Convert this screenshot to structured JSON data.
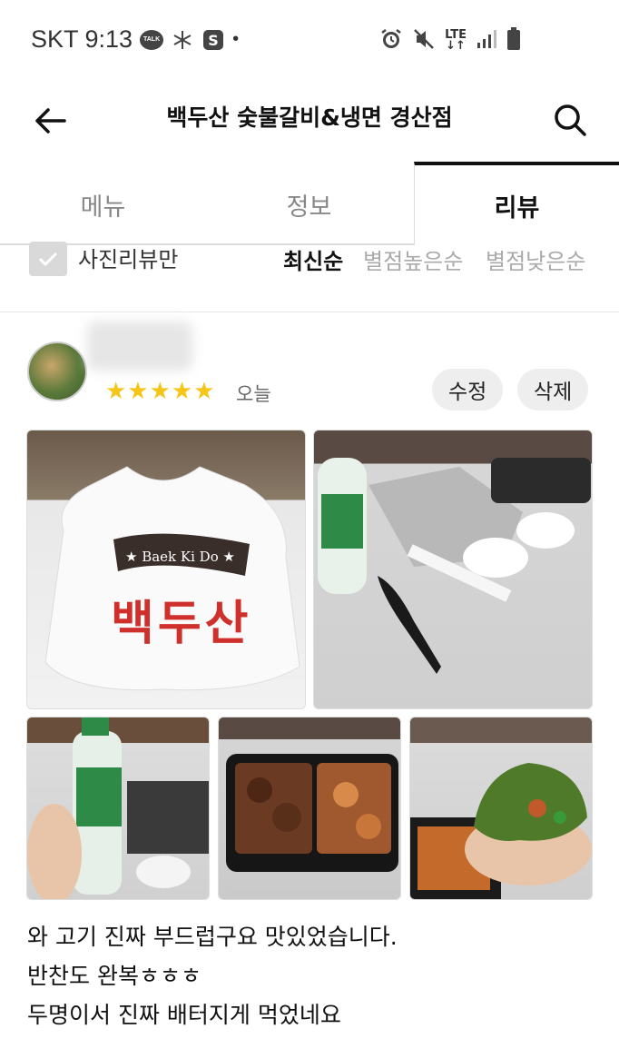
{
  "status": {
    "carrier_time": "SKT 9:13",
    "talk_badge": "TALK",
    "dot": "•",
    "network": "LTE",
    "icons": [
      "talk-icon",
      "snowflake-icon",
      "s-app-icon",
      "alarm-icon",
      "mute-icon",
      "signal-icon",
      "battery-icon"
    ]
  },
  "header": {
    "title": "백두산 숯불갈비&냉면 경산점",
    "back_icon": "arrow-left-icon",
    "search_icon": "search-icon"
  },
  "tabs": [
    {
      "label": "메뉴",
      "active": false
    },
    {
      "label": "정보",
      "active": false
    },
    {
      "label": "리뷰",
      "active": true
    }
  ],
  "filter": {
    "photo_only_label": "사진리뷰만",
    "photo_only_checked": false,
    "sort_options": [
      {
        "label": "최신순",
        "active": true
      },
      {
        "label": "별점높은순",
        "active": false
      },
      {
        "label": "별점낮은순",
        "active": false
      }
    ]
  },
  "review": {
    "rating": 5,
    "stars": "★★★★★",
    "date": "오늘",
    "edit_label": "수정",
    "delete_label": "삭제",
    "bag_text_brand": "★ Baek Ki Do ★",
    "bag_text_name": "백두산",
    "lines": [
      "와 고기 진짜 부드럽구요 맛있었습니다.",
      "반찬도 완복ㅎㅎㅎ",
      "두명이서 진짜 배터지게 먹었네요"
    ]
  },
  "colors": {
    "accent": "#111111",
    "star": "#f5c518",
    "tab_inactive": "#888888",
    "pill_bg": "#eeeeee"
  }
}
